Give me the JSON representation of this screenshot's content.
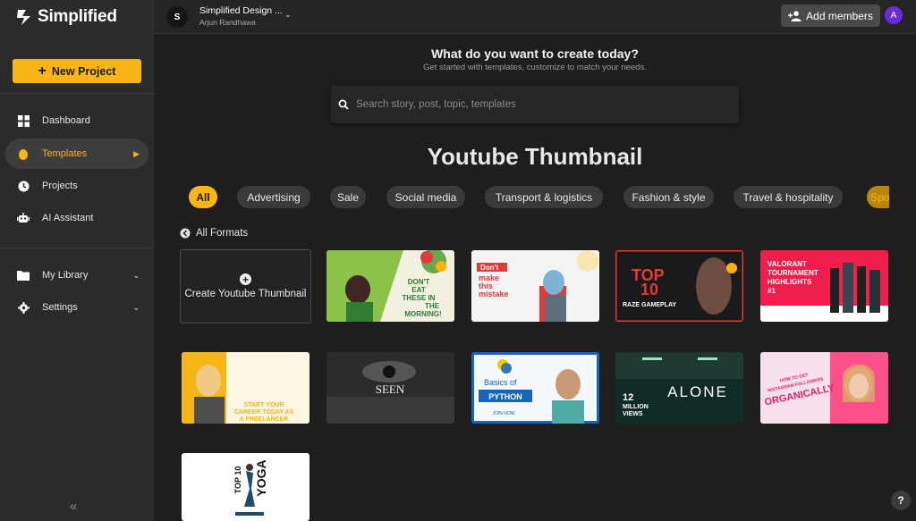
{
  "app": {
    "logo_text": "Simplified",
    "new_project_label": "New Project"
  },
  "sidebar": {
    "nav": [
      {
        "label": "Dashboard",
        "icon": "grid-icon"
      },
      {
        "label": "Templates",
        "icon": "drop-icon",
        "active": true
      },
      {
        "label": "Projects",
        "icon": "clock-icon"
      },
      {
        "label": "AI Assistant",
        "icon": "robot-icon"
      }
    ],
    "library": [
      {
        "label": "My Library",
        "icon": "folder-icon"
      },
      {
        "label": "Settings",
        "icon": "gear-icon"
      }
    ]
  },
  "topbar": {
    "workspace_initial": "S",
    "workspace_name": "Simplified Design ...",
    "workspace_user": "Arjun Randhawa",
    "add_members_label": "Add members",
    "user_initial": "A"
  },
  "main": {
    "heading": "What do you want to create today?",
    "subheading": "Get started with templates, customize to match your needs.",
    "search_placeholder": "Search story, post, topic, templates",
    "section_title": "Youtube Thumbnail",
    "all_formats_label": "All Formats",
    "create_card_label": "Create Youtube Thumbnail",
    "chips": [
      "All",
      "Advertising",
      "Sale",
      "Social media",
      "Transport & logistics",
      "Fashion & style",
      "Travel & hospitality",
      "Spo"
    ]
  },
  "thumbnails": {
    "t1": {
      "line1": "DON'T",
      "line2": "EAT",
      "line3": "THESE IN",
      "line4": "THE",
      "line5": "MORNING!"
    },
    "t2": {
      "line1": "Don't",
      "line2": "make",
      "line3": "this",
      "line4": "mistake"
    },
    "t3": {
      "line1": "TOP",
      "line2": "10",
      "line3": "RAZE GAMEPLAY"
    },
    "t4": {
      "line1": "VALORANT",
      "line2": "TOURNAMENT",
      "line3": "HIGHLIGHTS",
      "line4": "#1"
    },
    "t5": {
      "line1": "START YOUR",
      "line2": "CAREER TODAY AS",
      "line3": "A FREELANCER"
    },
    "t6": {
      "line1": "SEEN"
    },
    "t7": {
      "line1": "Basics of",
      "line2": "PYTHON",
      "line3": "JOIN NOW"
    },
    "t8": {
      "line1": "12",
      "line2": "MILLION",
      "line3": "VIEWS",
      "line4": "ALONE"
    },
    "t9": {
      "line1": "HOW TO GET",
      "line2": "INSTAGRAM FOLLOWERS",
      "line3": "ORGANICALLY"
    },
    "t10": {
      "line1": "TOP 10",
      "line2": "YOGA"
    }
  },
  "colors": {
    "accent": "#f7b615",
    "sidebar_bg": "#2b2b2b",
    "main_bg": "#1e1e1e",
    "avatar_purple": "#6a2bd9"
  }
}
